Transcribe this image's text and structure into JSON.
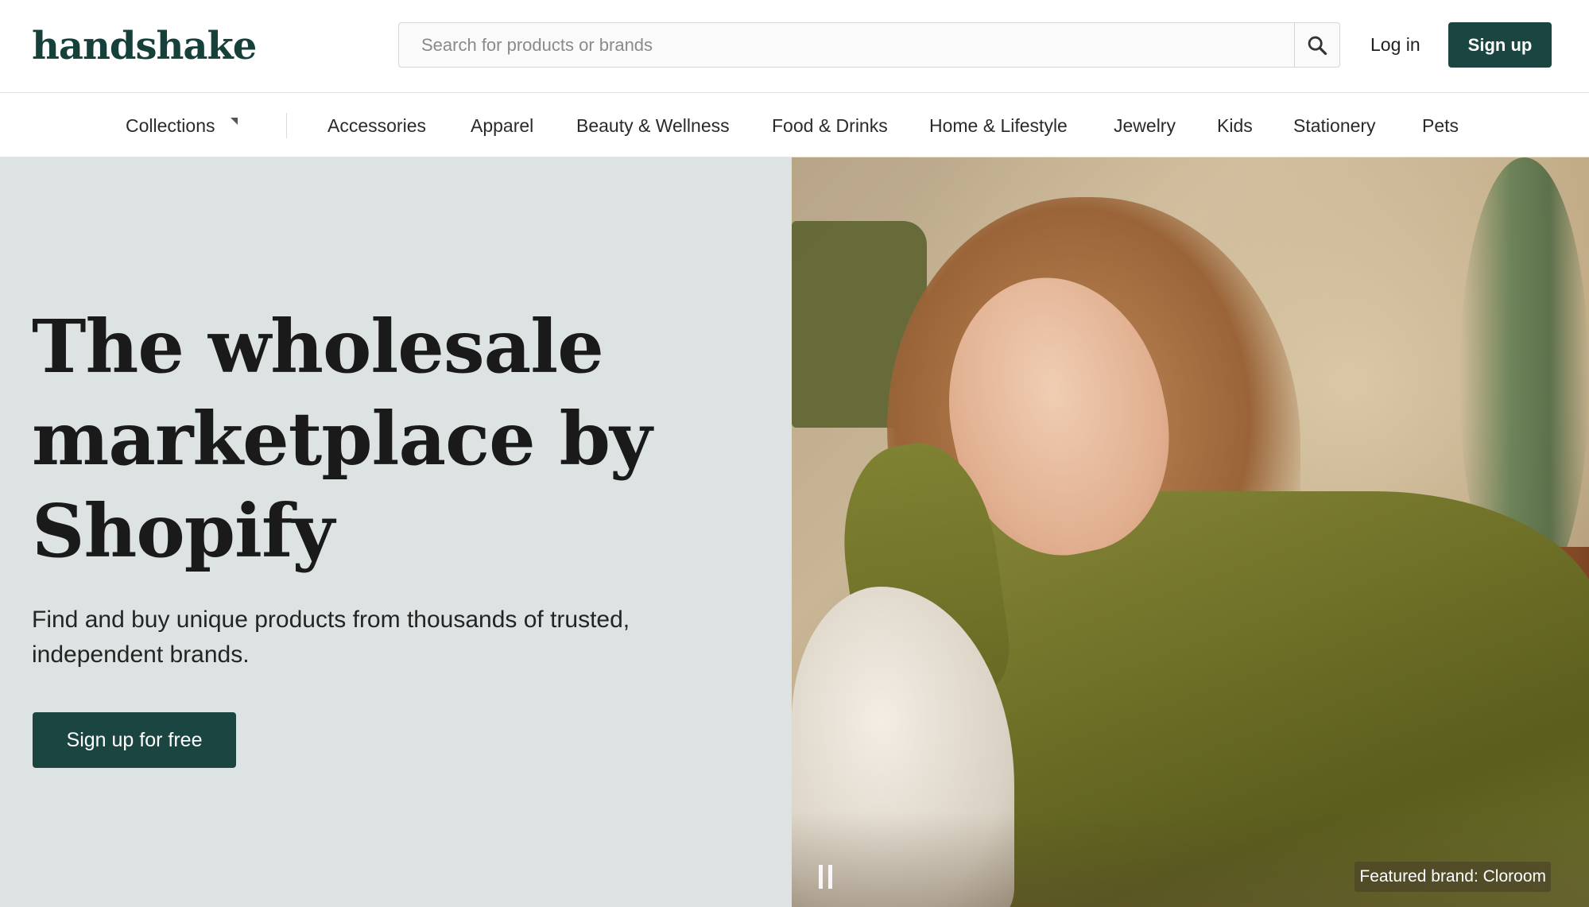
{
  "header": {
    "logo": "handshake",
    "search_placeholder": "Search for products or brands",
    "login_label": "Log in",
    "signup_label": "Sign up"
  },
  "nav": {
    "items": [
      {
        "label": "Collections"
      },
      {
        "label": "Accessories"
      },
      {
        "label": "Apparel"
      },
      {
        "label": "Beauty & Wellness"
      },
      {
        "label": "Food & Drinks"
      },
      {
        "label": "Home & Lifestyle"
      },
      {
        "label": "Jewelry"
      },
      {
        "label": "Kids"
      },
      {
        "label": "Stationery"
      },
      {
        "label": "Pets"
      }
    ]
  },
  "hero": {
    "title_lines": [
      "The wholesale",
      "marketplace by",
      "Shopify"
    ],
    "subtitle": "Find and buy unique products from thousands of trusted, independent brands.",
    "cta_label": "Sign up for free",
    "featured_caption": "Featured brand: Cloroom"
  },
  "colors": {
    "brand_green": "#1a4540",
    "logo_green": "#16403a",
    "hero_bg": "#dce3e2"
  },
  "icons": {
    "search": "search-icon",
    "pause": "pause-icon",
    "caret": "caret-down-icon"
  }
}
